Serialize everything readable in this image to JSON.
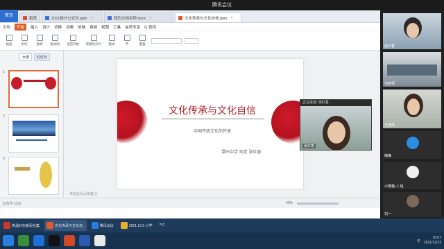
{
  "window": {
    "title": "腾讯会议"
  },
  "tabs": [
    {
      "label": "首页",
      "color": "#2f6fd0"
    },
    {
      "label": "稻壳",
      "color": "#e04a3a"
    },
    {
      "label": "2021统计公式示.pptx",
      "color": "#3a6fd8"
    },
    {
      "label": "我的文档名称.docx",
      "color": "#3a6fd8"
    },
    {
      "label": "文化传承与文化自信.pptx",
      "color": "#e05a2a"
    }
  ],
  "menu": [
    "文件",
    "开始",
    "插入",
    "设计",
    "切换",
    "动画",
    "放映",
    "审阅",
    "视图",
    "工具",
    "会员专享",
    "Q 查找"
  ],
  "ribbon": [
    "粘贴",
    "剪切",
    "复制",
    "格式刷",
    "当前开始",
    "新建幻灯片",
    "版式",
    "节",
    "重置"
  ],
  "thumbtabs": [
    "大纲",
    "幻灯片"
  ],
  "thumb_nums": [
    "1",
    "2",
    "3"
  ],
  "slide": {
    "title": "文化传承与文化自信",
    "subtitle": "中国传统文化的传承",
    "author": "潭州中学  刘老  张红香"
  },
  "notes": "单击此处添加备注",
  "status": {
    "left": "幻灯片 1/15",
    "zoom": "63%"
  },
  "float_video": {
    "header": "正在讲话: 张红香",
    "name": "张红香"
  },
  "participants": [
    {
      "name": "张红香"
    },
    {
      "name": "刘老师"
    },
    {
      "name": "王老师"
    },
    {
      "name": "梅梅"
    },
    {
      "name": "海鲸"
    },
    {
      "name": "小熊猫--1 班"
    },
    {
      "name": "初一班家长"
    },
    {
      "name": "刘一"
    }
  ],
  "taskbar_top": [
    "高温红色新闻全集",
    "文化传承与文化自..",
    "腾讯会议",
    "2021.12.9 小学",
    "7°C"
  ],
  "tray": {
    "time": "10:07",
    "date": "2021/12/12",
    "lang": "中"
  }
}
